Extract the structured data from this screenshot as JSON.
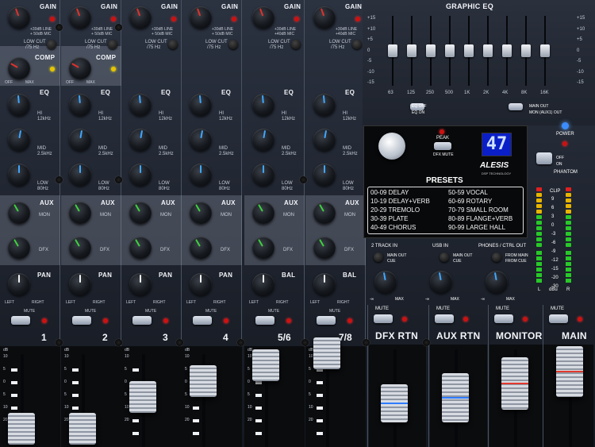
{
  "channels": [
    {
      "name": "1",
      "has_comp": true,
      "gain_label": "GAIN",
      "pan_label": "PAN"
    },
    {
      "name": "2",
      "has_comp": true,
      "gain_label": "GAIN",
      "pan_label": "PAN"
    },
    {
      "name": "3",
      "has_comp": false,
      "gain_label": "GAIN",
      "pan_label": "PAN"
    },
    {
      "name": "4",
      "has_comp": false,
      "gain_label": "GAIN",
      "pan_label": "PAN"
    },
    {
      "name": "5/6",
      "has_comp": false,
      "gain_label": "GAIN",
      "pan_label": "BAL"
    },
    {
      "name": "7/8",
      "has_comp": false,
      "gain_label": "GAIN",
      "pan_label": "BAL"
    }
  ],
  "labels": {
    "comp": "COMP",
    "eq": "EQ",
    "hi": "HI",
    "hi_freq": "12kHz",
    "mid": "MID",
    "mid_freq": "2.5kHz",
    "low": "LOW",
    "low_freq": "80Hz",
    "aux": "AUX",
    "mon": "MON",
    "dfx": "DFX",
    "left": "LEFT",
    "right": "RIGHT",
    "mute": "MUTE",
    "db": "dB",
    "low_cut": "LOW CUT",
    "low_cut_freq": "/75 Hz",
    "line_mic": "+30dB LINE",
    "mic": "+ 50dB MIC",
    "line_mic2": "+40dB MIC",
    "off": "OFF",
    "max": "MAX",
    "minus_inf": "-∞",
    "plus10": "+10dB"
  },
  "graphic_eq": {
    "title": "GRAPHIC EQ",
    "bands": [
      "63",
      "125",
      "250",
      "500",
      "1K",
      "2K",
      "4K",
      "8K",
      "16K"
    ],
    "levels": [
      0,
      0,
      0,
      0,
      0,
      0,
      0,
      0,
      0
    ],
    "scale": [
      "+15",
      "+10",
      "+5",
      "0",
      "-5",
      "-10",
      "-15"
    ],
    "eq_off": "EQ OFF",
    "eq_on": "EQ ON",
    "main_out": "MAIN OUT",
    "mon_out": "MON (AUX1) OUT"
  },
  "fx": {
    "peak": "PEAK",
    "dfx_mute": "DFX MUTE",
    "display": "47",
    "brand": "ALESIS",
    "brand_sub": "DSP TECHNOLOGY",
    "presets_title": "PRESETS",
    "presets_left": [
      "00-09 DELAY",
      "10-19 DELAY+VERB",
      "20-29 TREMOLO",
      "30-39 PLATE",
      "40-49 CHORUS"
    ],
    "presets_right": [
      "50-59 VOCAL",
      "60-69 ROTARY",
      "70-79 SMALL ROOM",
      "80-89 FLANGE+VERB",
      "90-99 LARGE HALL"
    ]
  },
  "power": {
    "power": "POWER",
    "off": "OFF",
    "on": "ON",
    "phantom": "PHANTOM"
  },
  "meter": {
    "clip": "CLIP",
    "scale": [
      "9",
      "6",
      "3",
      "0",
      "-3",
      "-6",
      "-9",
      "-12",
      "-15",
      "-20",
      "-30"
    ],
    "l": "L",
    "r": "R",
    "dbu": "dBu"
  },
  "inputs": {
    "two_track": "2 TRACK IN",
    "usb": "USB IN",
    "phones": "PHONES / CTRL OUT",
    "main_out_cue": "MAIN OUT",
    "cue": "CUE",
    "from_main": "FROM MAIN",
    "from_cue": "FROM CUE"
  },
  "returns": [
    {
      "name": "DFX RTN",
      "mute": "MUTE",
      "line": "#2e7bff"
    },
    {
      "name": "AUX RTN",
      "mute": "MUTE",
      "line": "#2e7bff"
    },
    {
      "name": "MONITOR",
      "mute": "MUTE",
      "line": "#e23a2e"
    },
    {
      "name": "MAIN",
      "mute": "MUTE",
      "line": "#e23a2e"
    }
  ],
  "fader_scale": [
    "10",
    "5",
    "0",
    "5",
    "10",
    "20"
  ]
}
